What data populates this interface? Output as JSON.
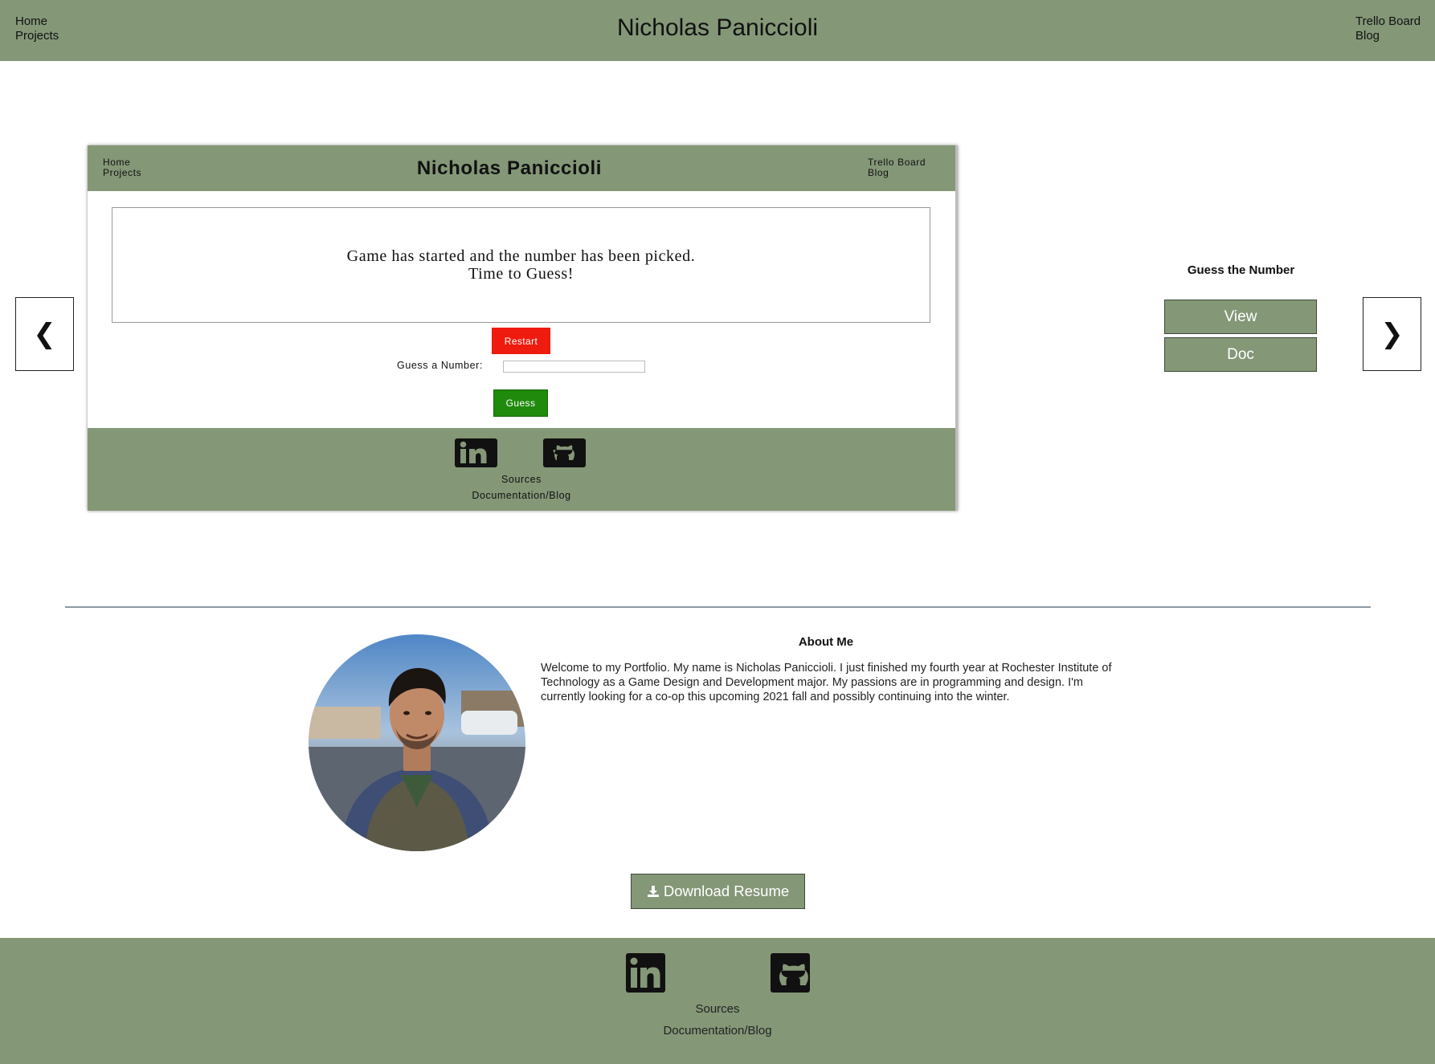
{
  "header": {
    "title": "Nicholas Paniccioli",
    "nav_left": [
      "Home",
      "Projects"
    ],
    "nav_right": [
      "Trello Board",
      "Blog"
    ]
  },
  "carousel": {
    "prev_label": "❮",
    "next_label": "❯",
    "screenshot": {
      "title": "Nicholas Paniccioli",
      "nav_left": [
        "Home",
        "Projects"
      ],
      "nav_right": [
        "Trello Board",
        "Blog"
      ],
      "message_line1": "Game has started and the number has been picked.",
      "message_line2": "Time to Guess!",
      "restart_label": "Restart",
      "guess_label": "Guess a Number:",
      "guess_button_label": "Guess",
      "footer_sources": "Sources",
      "footer_docs": "Documentation/Blog"
    },
    "project_title": "Guess the Number",
    "view_label": "View",
    "doc_label": "Doc"
  },
  "about": {
    "title": "About Me",
    "text": "Welcome to my Portfolio. My name is Nicholas Paniccioli. I just finished my fourth year at Rochester Institute of Technology as a Game Design and Development major. My passions are in programming and design. I'm currently looking for a co-op this upcoming 2021 fall and possibly continuing into the winter.",
    "download_label": "Download Resume",
    "download_icon": "download-icon"
  },
  "footer": {
    "sources": "Sources",
    "docs": "Documentation/Blog",
    "icons": [
      "linkedin-icon",
      "github-icon"
    ]
  },
  "colors": {
    "accent_green": "#849777",
    "restart_red": "#ef1b0f",
    "guess_green": "#1f8a0c",
    "divider": "#8c9aa3"
  }
}
